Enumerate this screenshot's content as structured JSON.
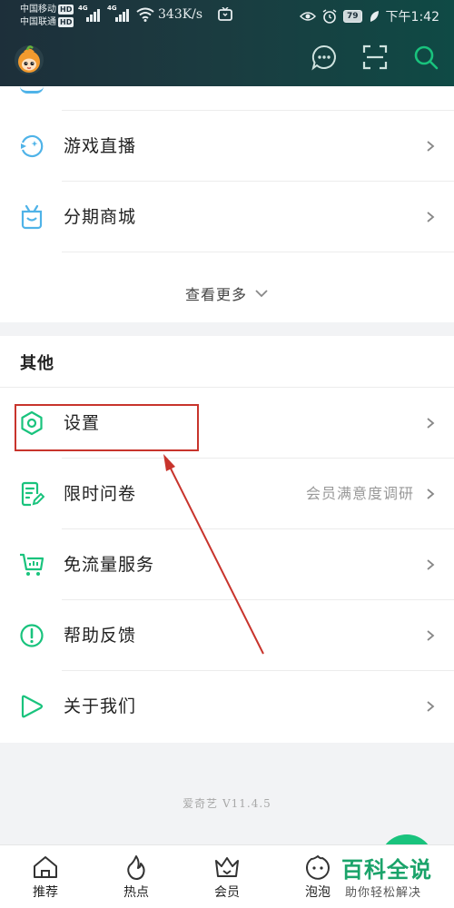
{
  "status_bar": {
    "carrier1": "中国移动",
    "carrier2": "中国联通",
    "hd": "HD",
    "network": "4G",
    "speed": "343K/s",
    "battery": "79",
    "time": "下午1:42"
  },
  "card1": {
    "items": [
      {
        "label": "游戏直播",
        "icon": "game-live-icon"
      },
      {
        "label": "分期商城",
        "icon": "shop-bag-icon"
      }
    ],
    "see_more": "查看更多"
  },
  "other_section": {
    "title": "其他",
    "items": [
      {
        "label": "设置",
        "icon": "settings-hex-icon",
        "value": ""
      },
      {
        "label": "限时问卷",
        "icon": "survey-icon",
        "value": "会员满意度调研"
      },
      {
        "label": "免流量服务",
        "icon": "cart-data-icon",
        "value": ""
      },
      {
        "label": "帮助反馈",
        "icon": "help-exclamation-icon",
        "value": ""
      },
      {
        "label": "关于我们",
        "icon": "play-about-icon",
        "value": ""
      }
    ]
  },
  "version": "爱奇艺 V11.4.5",
  "bottom_nav": {
    "items": [
      {
        "label": "推荐",
        "icon": "home-icon"
      },
      {
        "label": "热点",
        "icon": "flame-icon"
      },
      {
        "label": "会员",
        "icon": "crown-icon"
      },
      {
        "label": "泡泡",
        "icon": "bubble-face-icon"
      }
    ]
  },
  "watermark": {
    "title": "百科全说",
    "subtitle": "助你轻松解决"
  },
  "colors": {
    "accent": "#19c37d",
    "header_bg": "#1d2f3a",
    "highlight": "#c8342c",
    "icon_blue": "#4fb3e8"
  }
}
